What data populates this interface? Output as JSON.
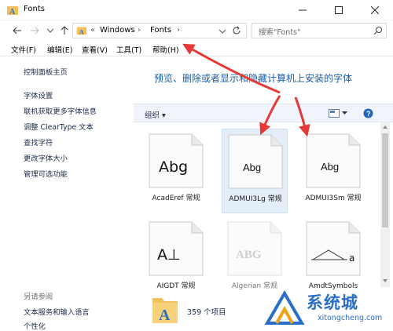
{
  "window": {
    "title": "Fonts",
    "icons": {
      "app": "fonts-folder-icon",
      "minimize": "minimize-icon",
      "maximize": "maximize-icon",
      "close": "close-icon"
    }
  },
  "address": {
    "prefix": "«",
    "crumbs": [
      "Windows",
      "Fonts"
    ],
    "search_placeholder": "搜索\"Fonts\""
  },
  "menu": [
    "文件(F)",
    "编辑(E)",
    "查看(V)",
    "工具(T)",
    "帮助(H)"
  ],
  "sidebar": {
    "items": [
      "控制面板主页",
      "字体设置",
      "联机获取更多字体信息",
      "调整 ClearType 文本",
      "查找字符",
      "更改字体大小",
      "管理可选功能"
    ],
    "see_also_title": "另请参阅",
    "see_also": [
      "文本服务和输入语言",
      "个性化"
    ]
  },
  "main": {
    "headline": "预览、删除或者显示和隐藏计算机上安装的字体",
    "organize": "组织 ▾",
    "fonts": [
      {
        "label": "AcadEref 常规",
        "preview": "Abg",
        "selected": false
      },
      {
        "label": "ADMUI3Lg 常规",
        "preview": "Abg",
        "selected": true
      },
      {
        "label": "ADMUI3Sm 常规",
        "preview": "Abg",
        "selected": false
      },
      {
        "label": "AIGDT 常规",
        "preview": "A⊥",
        "selected": false
      },
      {
        "label": "Algerian 常规",
        "preview": "ABG",
        "selected": false
      },
      {
        "label": "AmdtSymbols",
        "preview": "a",
        "selected": false
      }
    ],
    "status": "359 个项目"
  },
  "watermark": {
    "name": "系统城",
    "url": "xitongcheng.com"
  },
  "colors": {
    "accent": "#1a5ea8",
    "arrow": "#e53935",
    "selection": "#e3eef9"
  }
}
